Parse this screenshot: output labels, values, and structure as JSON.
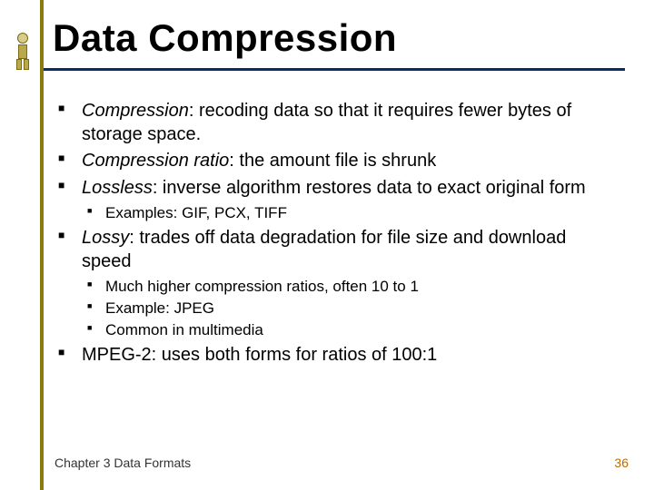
{
  "title": "Data Compression",
  "bullets": {
    "b1_term": "Compression",
    "b1_rest": ":  recoding data so that it requires fewer bytes of storage space.",
    "b2_term": "Compression ratio",
    "b2_rest": ": the amount file is shrunk",
    "b3_term": "Lossless",
    "b3_rest": ": inverse algorithm restores data to exact original form",
    "b3_sub1": "Examples:  GIF, PCX, TIFF",
    "b4_term": "Lossy",
    "b4_rest": ": trades off data degradation for file size and download speed",
    "b4_sub1": "Much higher compression ratios, often 10 to 1",
    "b4_sub2": "Example:  JPEG",
    "b4_sub3": "Common in multimedia",
    "b5": "MPEG-2: uses both forms for ratios of 100:1"
  },
  "footer": {
    "chapter": "Chapter 3 Data Formats",
    "page": "36"
  }
}
